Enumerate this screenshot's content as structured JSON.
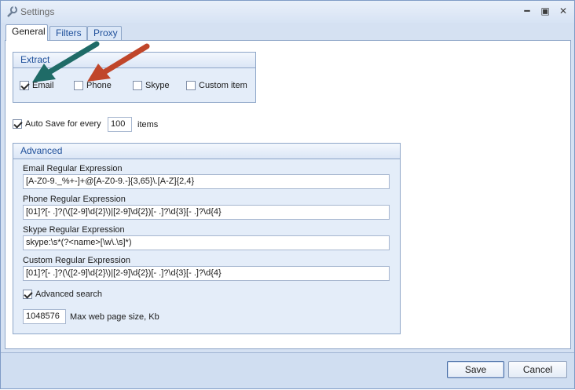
{
  "window": {
    "title": "Settings",
    "minimize_label": "━",
    "maximize_label": "▣",
    "close_label": "✕"
  },
  "tabs": [
    {
      "label": "General"
    },
    {
      "label": "Filters"
    },
    {
      "label": "Proxy"
    }
  ],
  "extract": {
    "header": "Extract",
    "items": [
      {
        "label": "Email",
        "checked": true
      },
      {
        "label": "Phone",
        "checked": false
      },
      {
        "label": "Skype",
        "checked": false
      },
      {
        "label": "Custom item",
        "checked": false
      }
    ]
  },
  "autosave": {
    "label": "Auto Save for every",
    "value": "100",
    "suffix": "items",
    "checked": true
  },
  "advanced": {
    "header": "Advanced",
    "email_label": "Email Regular Expression",
    "email_value": "[A-Z0-9._%+-]+@[A-Z0-9.-]{3,65}\\.[A-Z]{2,4}",
    "phone_label": "Phone Regular Expression",
    "phone_value": "[01]?[- .]?(\\([2-9]\\d{2}\\)|[2-9]\\d{2})[- .]?\\d{3}[- .]?\\d{4}",
    "skype_label": "Skype Regular Expression",
    "skype_value": "skype:\\s*(?<name>[\\w\\.\\s]*)",
    "custom_label": "Custom Regular Expression",
    "custom_value": "[01]?[- .]?(\\([2-9]\\d{2}\\)|[2-9]\\d{2})[- .]?\\d{3}[- .]?\\d{4}",
    "advanced_search_label": "Advanced search",
    "advanced_search_checked": true,
    "max_size_value": "1048576",
    "max_size_label": "Max web page size, Kb"
  },
  "footer": {
    "save_label": "Save",
    "cancel_label": "Cancel"
  },
  "annotation_colors": {
    "teal_arrow": "#1f6b67",
    "red_arrow": "#c0462a"
  }
}
